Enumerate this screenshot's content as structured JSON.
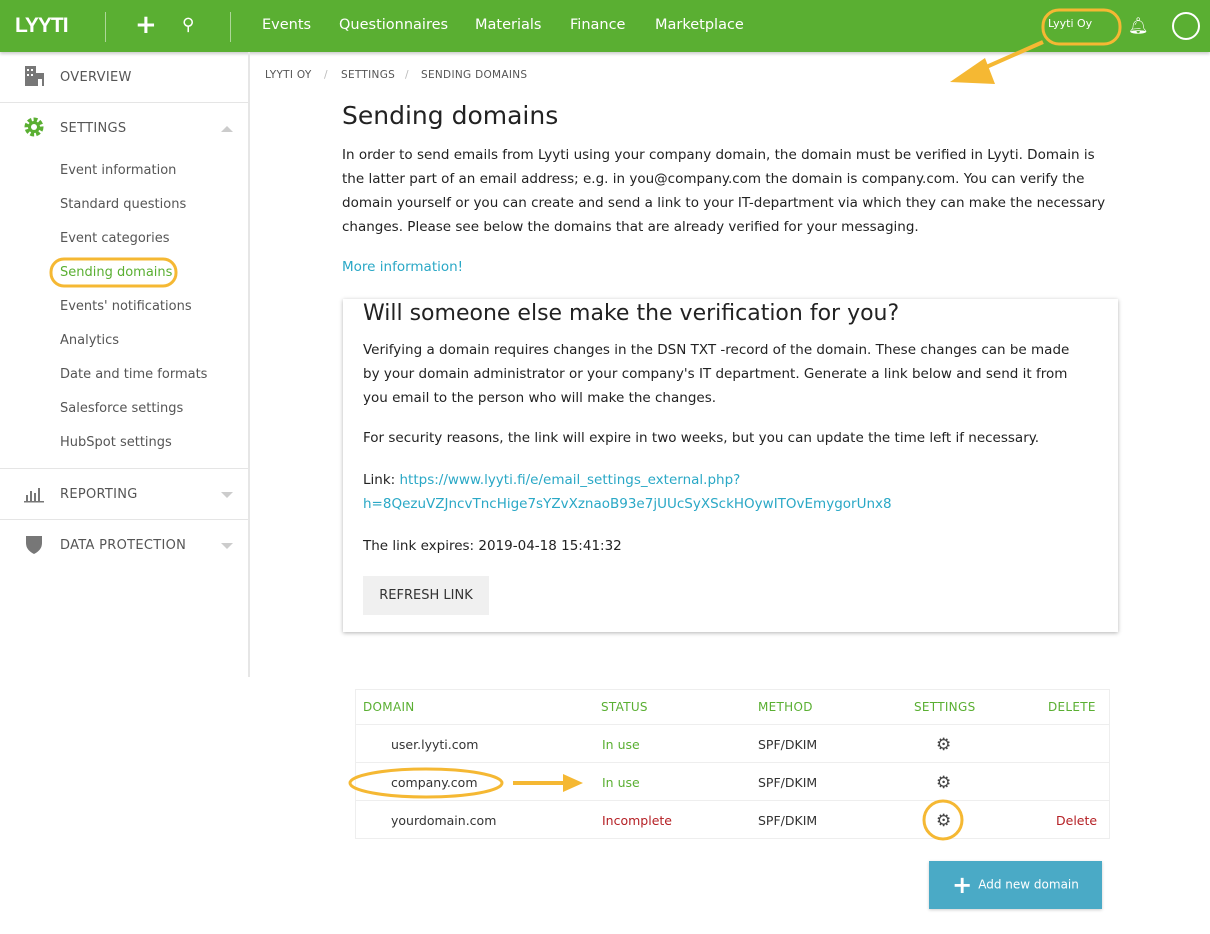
{
  "topbar": {
    "logo": "LYYTI",
    "nav": [
      "Events",
      "Questionnaires",
      "Materials",
      "Finance",
      "Marketplace"
    ],
    "company": "Lyyti Oy",
    "icons": [
      "plus-icon",
      "search-icon",
      "bell-icon",
      "avatar-icon"
    ]
  },
  "sidebar": {
    "overview": "OVERVIEW",
    "settings": "SETTINGS",
    "settings_items": [
      "Event information",
      "Standard questions",
      "Event categories",
      "Sending domains",
      "Events' notifications",
      "Analytics",
      "Date and time formats",
      "Salesforce settings",
      "HubSpot settings"
    ],
    "active": "Sending domains",
    "reporting": "REPORTING",
    "data_protection": "DATA PROTECTION"
  },
  "breadcrumb": [
    "LYYTI OY",
    "SETTINGS",
    "SENDING DOMAINS"
  ],
  "main": {
    "title": "Sending domains",
    "intro": "In order to send emails from Lyyti using your company domain, the domain must be verified in Lyyti. Domain is the latter part of an email address; e.g. in you@company.com the domain is company.com. You can verify the domain yourself or you can create and send a link to your IT-department via which they can make the necessary changes. Please see below the domains that are already verified for your messaging.",
    "more_info": "More information!"
  },
  "card": {
    "title": "Will someone else make the verification for you?",
    "p1": "Verifying a domain requires changes in the DSN TXT -record of the domain. These changes can be made by your domain administrator or your company's IT department. Generate a link below and send it from you email to the person who will make the changes.",
    "p2": "For security reasons, the link will expire in two weeks, but you can update the time left if necessary.",
    "link_label": "Link: ",
    "link_line1": "https://www.lyyti.fi/e/email_settings_external.php?",
    "link_line2": "h=8QezuVZJncvTncHige7sYZvXznaoB93e7jUUcSyXSckHOywITOvEmygorUnx8",
    "expires": "The link expires: 2019-04-18 15:41:32",
    "refresh": "REFRESH LINK"
  },
  "table": {
    "headers": [
      "DOMAIN",
      "STATUS",
      "METHOD",
      "SETTINGS",
      "DELETE"
    ],
    "rows": [
      {
        "domain": "user.lyyti.com",
        "status": "In use",
        "method": "SPF/DKIM",
        "delete": ""
      },
      {
        "domain": "company.com",
        "status": "In use",
        "method": "SPF/DKIM",
        "delete": ""
      },
      {
        "domain": "yourdomain.com",
        "status": "Incomplete",
        "method": "SPF/DKIM",
        "delete": "Delete"
      }
    ]
  },
  "add_button": "Add new domain",
  "colors": {
    "brand": "#5aaf32",
    "link": "#2aa8c6",
    "error": "#b52025",
    "annotation": "#f5b833",
    "button": "#4aaac6"
  }
}
